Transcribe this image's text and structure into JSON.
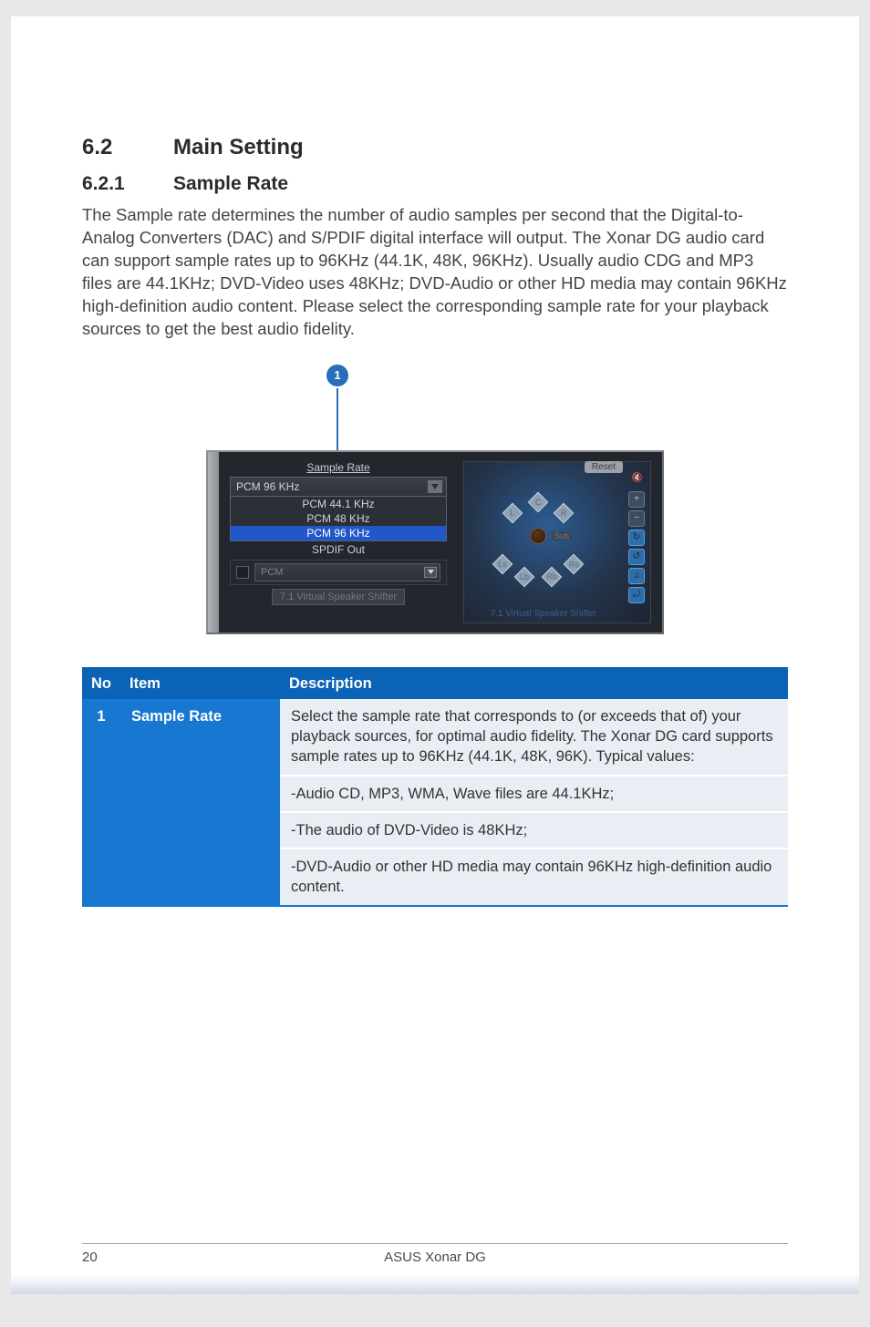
{
  "section": {
    "num": "6.2",
    "title": "Main Setting"
  },
  "subsection": {
    "num": "6.2.1",
    "title": "Sample Rate"
  },
  "body": "The Sample rate determines the number of audio samples per second that the Digital-to-Analog Converters (DAC) and S/PDIF digital interface will output. The Xonar DG audio card can support sample rates up to 96KHz (44.1K, 48K, 96KHz). Usually audio CDG and MP3 files are 44.1KHz; DVD-Video uses 48KHz; DVD-Audio or other HD media may contain 96KHz high-definition audio content. Please select the corresponding sample rate for your playback sources to get the best audio fidelity.",
  "callout": "1",
  "shot": {
    "sr_title": "Sample Rate",
    "combo_value": "PCM 96 KHz",
    "options": [
      {
        "label": "PCM 44.1 KHz",
        "sel": false
      },
      {
        "label": "PCM 48 KHz",
        "sel": false
      },
      {
        "label": "PCM 96 KHz",
        "sel": true
      }
    ],
    "spdif_label": "SPDIF Out",
    "pcm_label": "PCM",
    "vss_btn": "7.1 Virtual Speaker Shifter",
    "reset": "Reset",
    "speakers": {
      "L": "L",
      "C": "C",
      "R": "R",
      "Sub": "Sub",
      "Ls": "Ls",
      "Lb": "Lb",
      "Rb": "Rb",
      "Rs": "Rs"
    },
    "shifter": "7.1 Virtual Speaker Shifter"
  },
  "table": {
    "head": {
      "no": "No",
      "item": "Item",
      "desc": "Description"
    },
    "row": {
      "no": "1",
      "item": "Sample Rate",
      "d0": "Select the sample rate that corresponds to (or exceeds that of) your playback sources, for optimal audio fidelity. The Xonar DG card supports sample rates up to 96KHz (44.1K, 48K, 96K). Typical values:",
      "d1": "-Audio CD, MP3, WMA, Wave files are 44.1KHz;",
      "d2": "-The audio of DVD-Video is 48KHz;",
      "d3": "-DVD-Audio or other HD media may contain 96KHz high-definition audio content."
    }
  },
  "footer": {
    "page": "20",
    "title": "ASUS Xonar DG"
  }
}
